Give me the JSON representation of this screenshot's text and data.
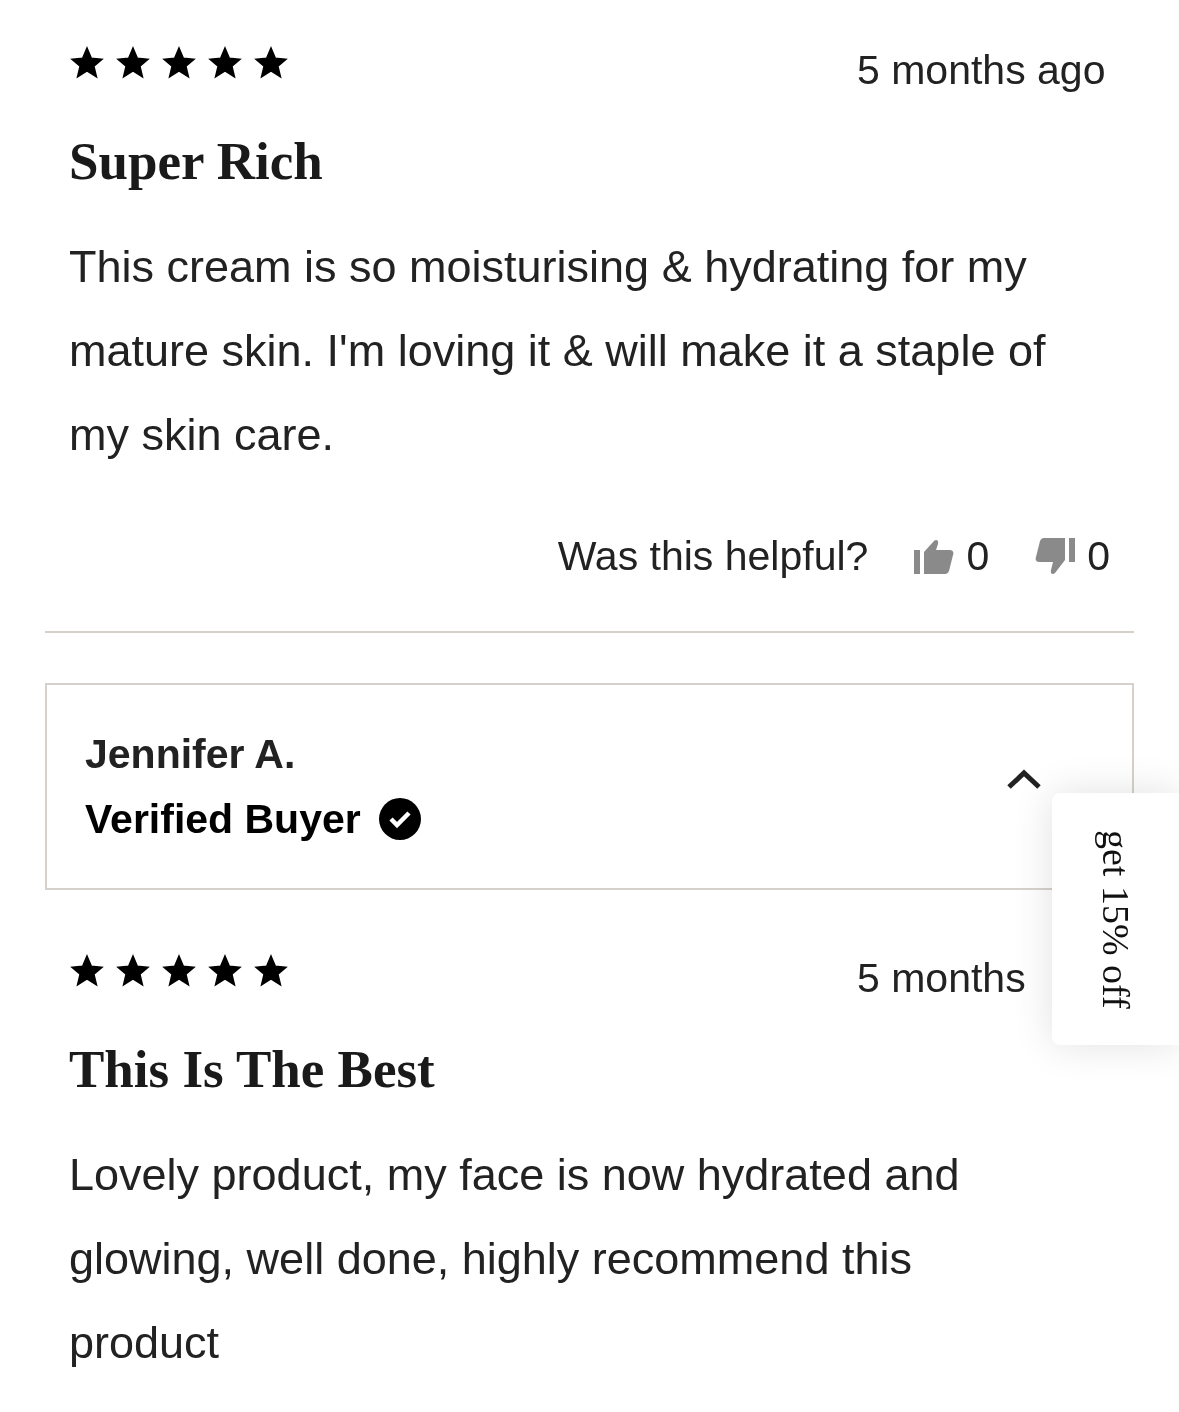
{
  "reviews": [
    {
      "stars": 5,
      "date": "5 months ago",
      "title": "Super Rich",
      "body": "This cream is so moisturising & hydrating for my mature skin. I'm loving it & will make it a staple of my skin care.",
      "helpful": {
        "label": "Was this helpful?",
        "up": "0",
        "down": "0"
      }
    },
    {
      "reviewer": {
        "name": "Jennifer A.",
        "badge": "Verified Buyer",
        "expanded": true
      },
      "stars": 5,
      "date": "5 months",
      "title": "This Is The Best",
      "body": "Lovely product, my face is now hydrated and glowing, well done, highly recommend this product"
    }
  ],
  "promo_tab": {
    "label": "get 15% off"
  }
}
